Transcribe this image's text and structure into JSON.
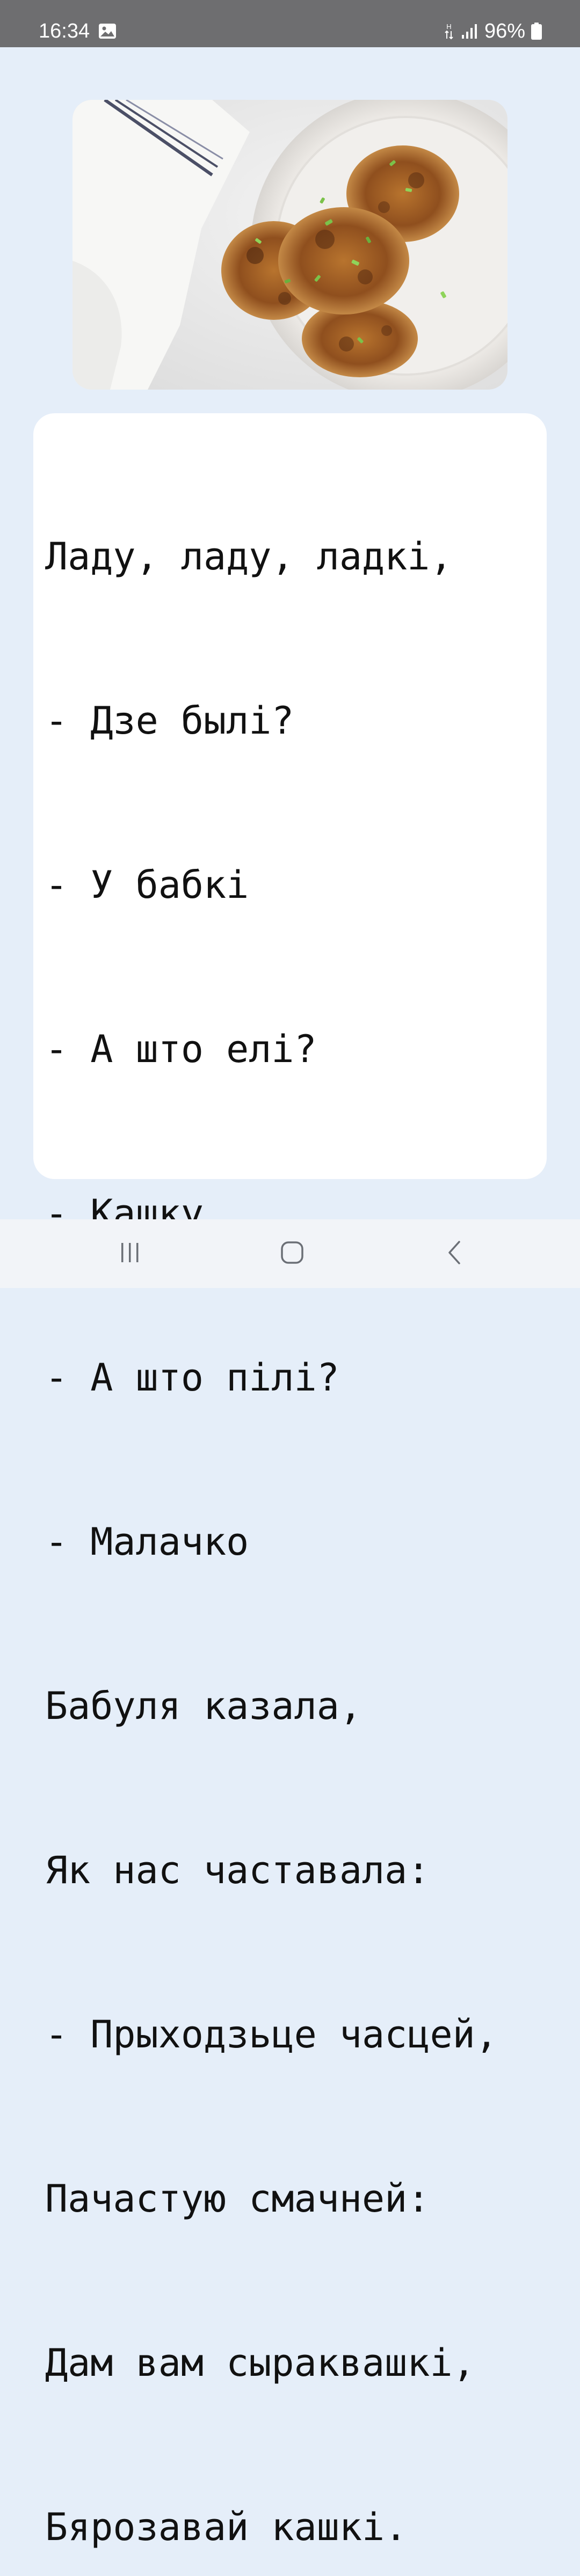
{
  "status_bar": {
    "time": "16:34",
    "battery": "96%",
    "icons": [
      "gallery-icon",
      "network-hplus-icon",
      "signal-icon",
      "battery-icon"
    ]
  },
  "image": {
    "subject": "fried potato pancakes with green onion on a white plate"
  },
  "poem": {
    "lines": [
      "Ладу, ладу, ладкі,",
      "- Дзе былі?",
      "- У бабкі",
      "- А што елі?",
      "- Кашку",
      "- А што пілі?",
      "- Малачко",
      "Бабуля казала,",
      "Як нас частавала:",
      "- Прыходзьце часцей,",
      "Пачастую смачней:",
      "Дам вам сыраквашкі,",
      "Бярозавай кашкі."
    ]
  },
  "nav_bar": {
    "icons": [
      "recent-apps-icon",
      "home-icon",
      "back-icon"
    ]
  },
  "colors": {
    "background": "#e5eef9",
    "status_bar": "#6e6e70",
    "card": "#ffffff",
    "nav_bar": "#f2f4f8"
  }
}
